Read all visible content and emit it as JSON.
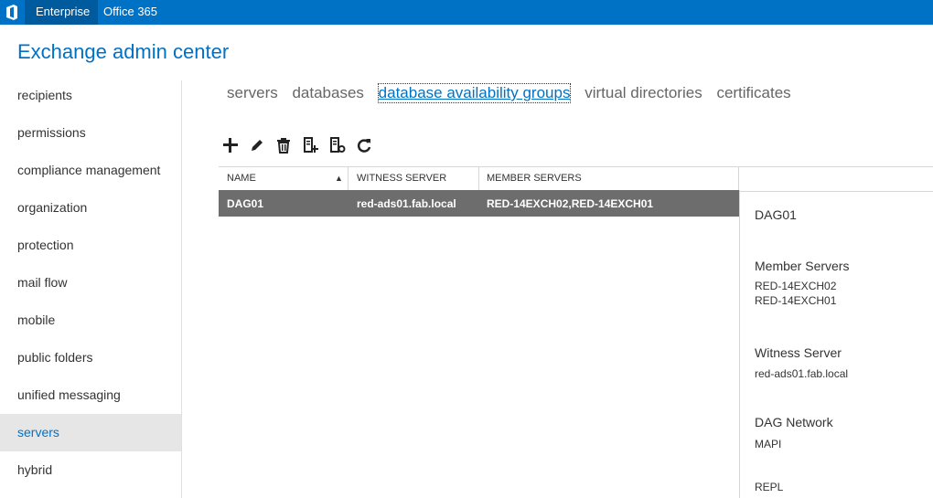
{
  "topbar": {
    "app_menu": "Enterprise",
    "office": "Office 365"
  },
  "app": {
    "title": "Exchange admin center"
  },
  "nav": {
    "items": [
      {
        "label": "recipients"
      },
      {
        "label": "permissions"
      },
      {
        "label": "compliance management"
      },
      {
        "label": "organization"
      },
      {
        "label": "protection"
      },
      {
        "label": "mail flow"
      },
      {
        "label": "mobile"
      },
      {
        "label": "public folders"
      },
      {
        "label": "unified messaging"
      },
      {
        "label": "servers"
      },
      {
        "label": "hybrid"
      }
    ],
    "selected": "servers"
  },
  "tabs": [
    {
      "label": "servers"
    },
    {
      "label": "databases"
    },
    {
      "label": "database availability groups"
    },
    {
      "label": "virtual directories"
    },
    {
      "label": "certificates"
    }
  ],
  "toolbar": {
    "icons": [
      "add-icon",
      "edit-icon",
      "delete-icon",
      "add-server-icon",
      "manage-network-icon",
      "refresh-icon"
    ]
  },
  "grid": {
    "columns": [
      "NAME",
      "WITNESS SERVER",
      "MEMBER SERVERS"
    ],
    "sort_indicator": "▲",
    "rows": [
      {
        "name": "DAG01",
        "witness": "red-ads01.fab.local",
        "members": "RED-14EXCH02,RED-14EXCH01"
      }
    ]
  },
  "details": {
    "name": "DAG01",
    "member_servers_label": "Member Servers",
    "member_servers": [
      "RED-14EXCH02",
      "RED-14EXCH01"
    ],
    "witness_label": "Witness Server",
    "witness": "red-ads01.fab.local",
    "network_label": "DAG Network",
    "networks": [
      "MAPI",
      "REPL"
    ]
  },
  "colors": {
    "brand": "#0072c6",
    "selected_row": "#6d6d6d"
  }
}
